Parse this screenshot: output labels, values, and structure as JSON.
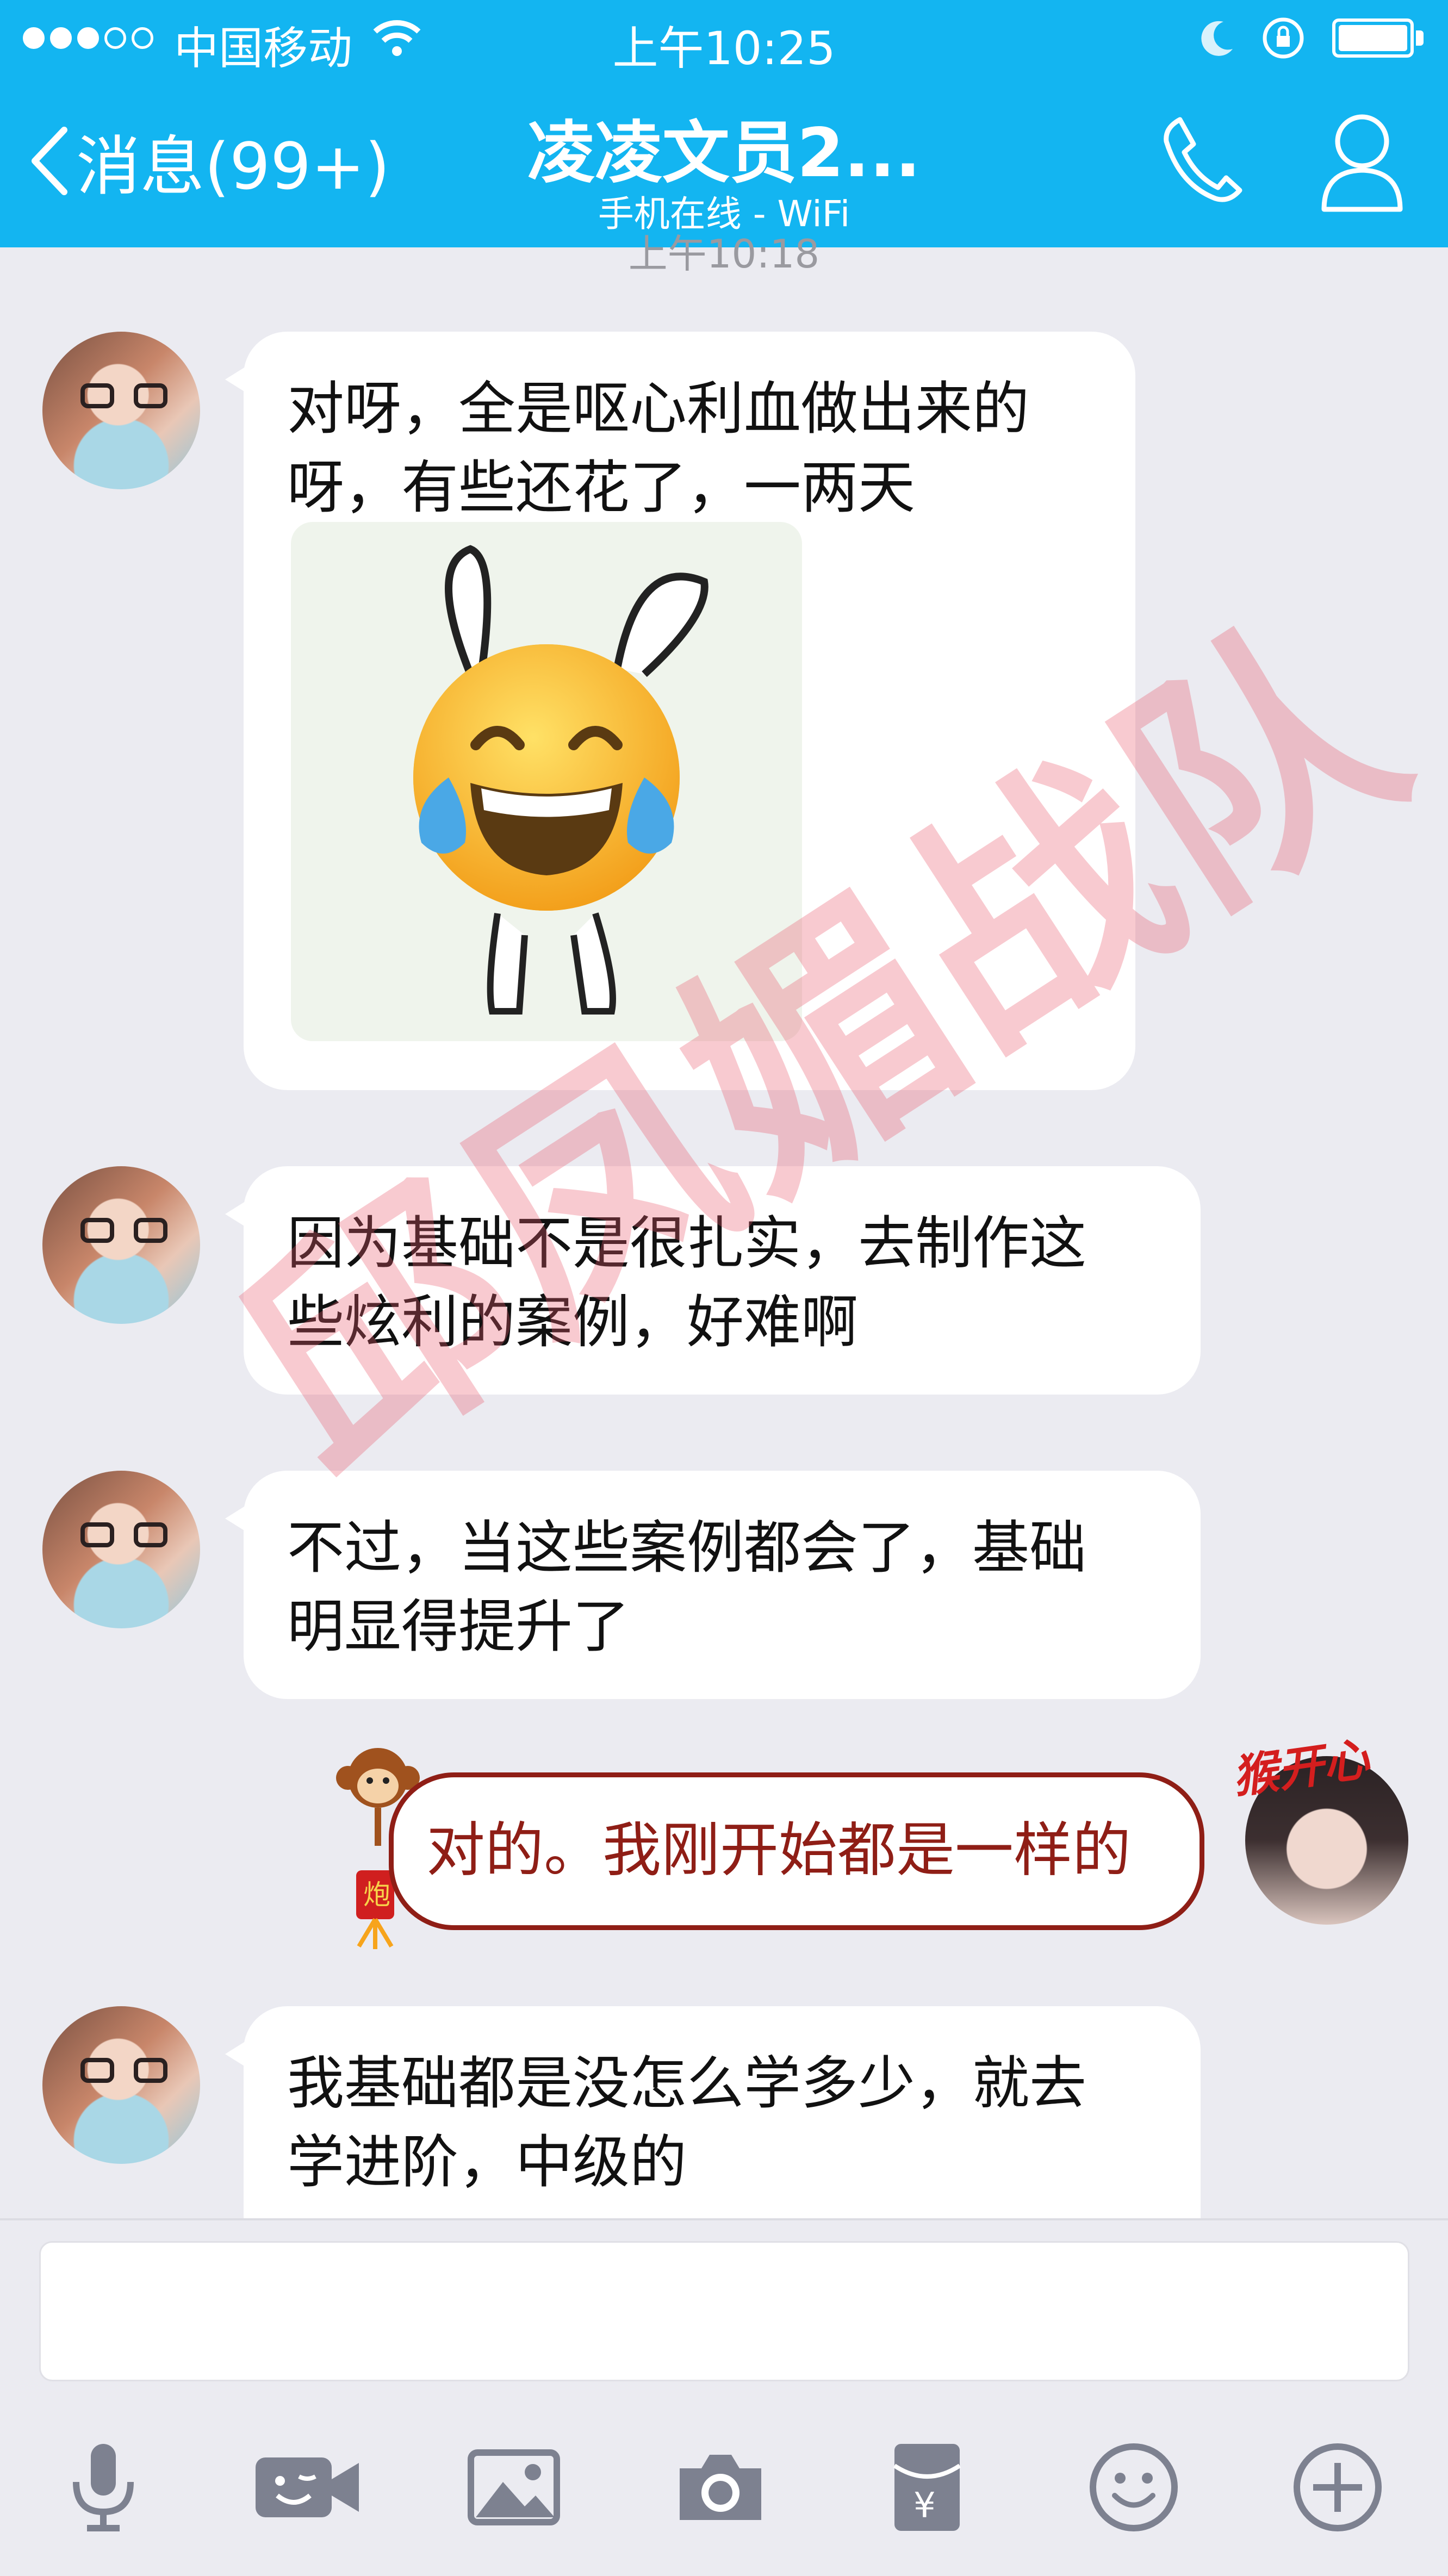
{
  "status_bar": {
    "carrier": "中国移动",
    "time": "上午10:25"
  },
  "nav": {
    "back_label": "消息(99+)",
    "title": "凌凌文员2...",
    "subtitle": "手机在线 - WiFi"
  },
  "timestamp_partial": "上午10:18",
  "messages": [
    {
      "side": "left",
      "text_lines": [
        "对呀，全是呕心利血做出来的",
        "呀，有些还花了，一两天"
      ],
      "has_sticker": true
    },
    {
      "side": "left",
      "text_lines": [
        "因为基础不是很扎实，去制作这",
        "些炫利的案例，好难啊"
      ]
    },
    {
      "side": "left",
      "text_lines": [
        "不过，当这些案例都会了，基础",
        "明显得提升了"
      ]
    },
    {
      "side": "right",
      "text_lines": [
        "对的。我刚开始都是一样的"
      ],
      "badge": "猴开心"
    },
    {
      "side": "left",
      "text_lines": [
        "我基础都是没怎么学多少，就去",
        "学进阶，中级的"
      ]
    }
  ],
  "toolbar": {
    "icons": [
      "microphone-icon",
      "video-icon",
      "image-icon",
      "camera-icon",
      "red-packet-icon",
      "emoji-icon",
      "plus-icon"
    ]
  },
  "watermark": "邱凤媚战队",
  "colors": {
    "header": "#13b5f1",
    "background": "#ebebf1",
    "bubble": "#ffffff",
    "out_bubble_border": "#8f1e16",
    "icon_gray": "#7d8190"
  }
}
